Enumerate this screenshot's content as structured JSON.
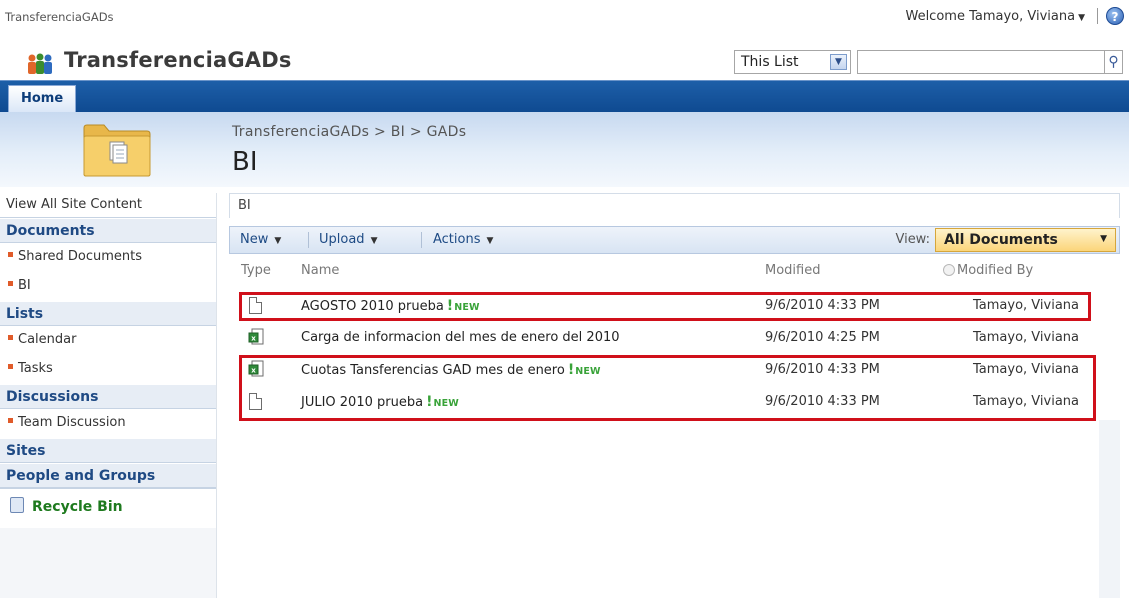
{
  "global": {
    "site_link": "TransferenciaGADs",
    "welcome": "Welcome Tamayo, Viviana",
    "help_glyph": "?"
  },
  "header": {
    "site_title": "TransferenciaGADs",
    "search_scope": "This List",
    "search_placeholder": ""
  },
  "tabs": [
    {
      "label": "Home"
    }
  ],
  "page": {
    "breadcrumb": "TransferenciaGADs > BI > GADs",
    "title": "BI"
  },
  "leftnav": {
    "view_all": "View All Site Content",
    "sections": [
      {
        "heading": "Documents",
        "items": [
          "Shared Documents",
          "BI"
        ]
      },
      {
        "heading": "Lists",
        "items": [
          "Calendar",
          "Tasks"
        ]
      },
      {
        "heading": "Discussions",
        "items": [
          "Team Discussion"
        ]
      },
      {
        "heading": "Sites",
        "items": []
      },
      {
        "heading": "People and Groups",
        "items": []
      }
    ],
    "recycle_bin": "Recycle Bin"
  },
  "list": {
    "title": "BI",
    "toolbar": {
      "new": "New",
      "upload": "Upload",
      "actions": "Actions",
      "view_label": "View:",
      "view_value": "All Documents"
    },
    "columns": {
      "type": "Type",
      "name": "Name",
      "modified": "Modified",
      "modified_by": "Modified By"
    },
    "new_marker": "!",
    "new_text": "NEW",
    "rows": [
      {
        "type": "document",
        "name": "AGOSTO 2010 prueba",
        "is_new": true,
        "modified": "9/6/2010 4:33 PM",
        "modified_by": "Tamayo, Viviana"
      },
      {
        "type": "excel",
        "name": "Carga de informacion del mes de enero del 2010",
        "is_new": false,
        "modified": "9/6/2010 4:25 PM",
        "modified_by": "Tamayo, Viviana"
      },
      {
        "type": "excel",
        "name": "Cuotas Tansferencias GAD mes de enero",
        "is_new": true,
        "modified": "9/6/2010 4:33 PM",
        "modified_by": "Tamayo, Viviana"
      },
      {
        "type": "document",
        "name": "JULIO 2010 prueba",
        "is_new": true,
        "modified": "9/6/2010 4:33 PM",
        "modified_by": "Tamayo, Viviana"
      }
    ]
  },
  "colors": {
    "highlight": "#d0101a",
    "accent_blue": "#1d5fa8",
    "new_green": "#39a339"
  }
}
